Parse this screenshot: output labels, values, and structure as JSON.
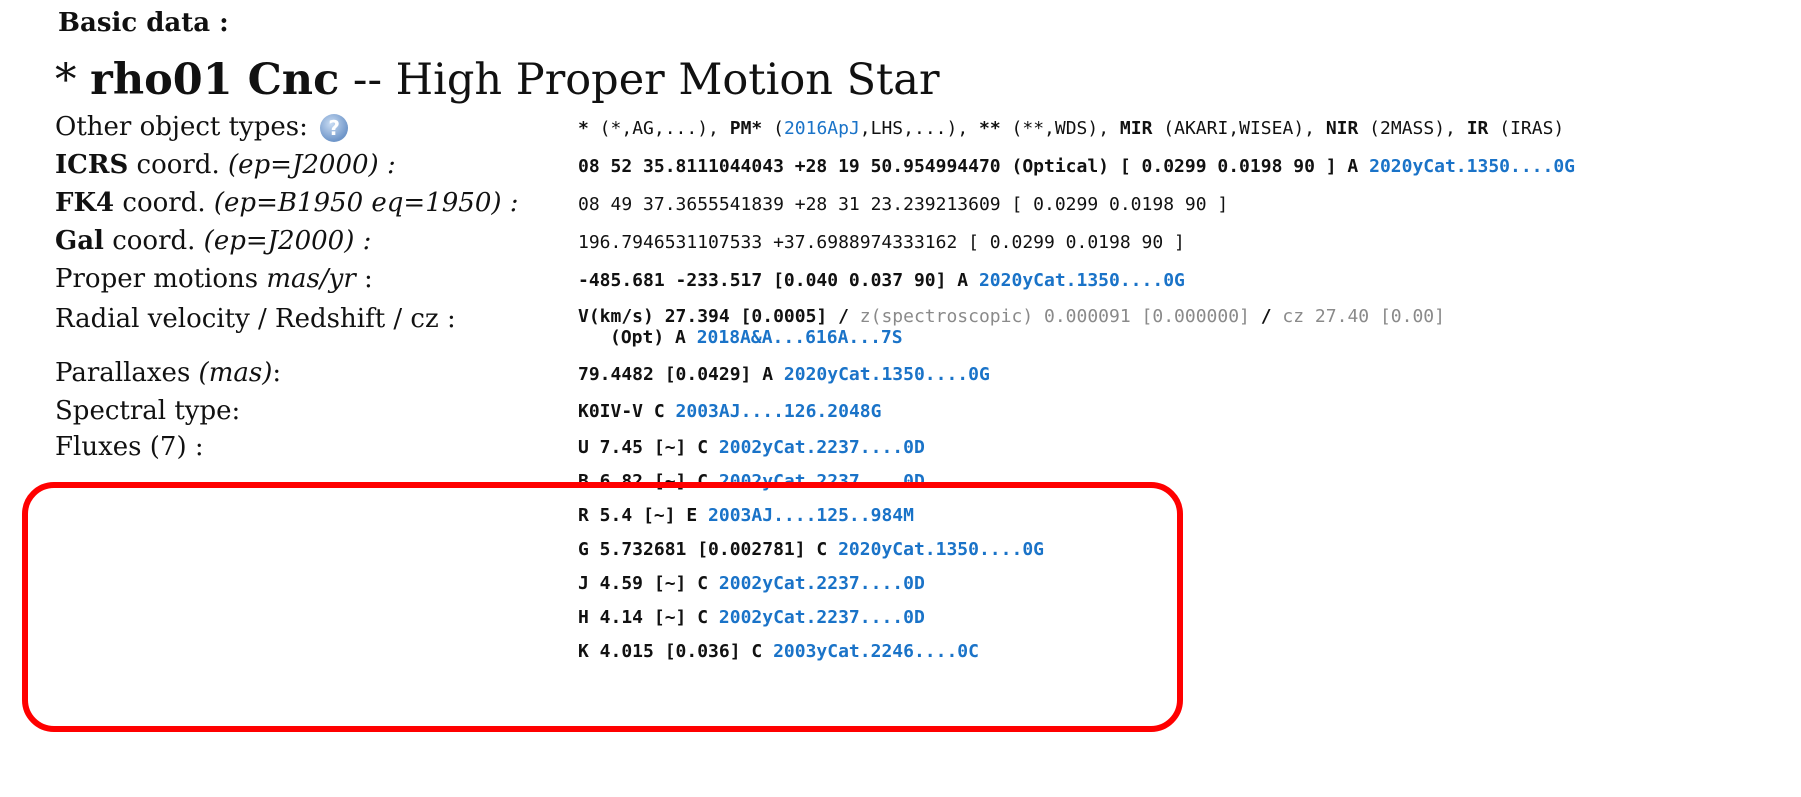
{
  "section_title": "Basic data :",
  "object": {
    "prefix": "* ",
    "name": "rho01 Cnc",
    "separator": " -- ",
    "type": "High Proper Motion Star"
  },
  "labels": {
    "other_types": "Other object types:",
    "icrs_bold": "ICRS",
    "icrs_rest": " coord. ",
    "icrs_italic": "(ep=J2000) :",
    "fk4_bold": "FK4",
    "fk4_rest": " coord. ",
    "fk4_italic": "(ep=B1950 eq=1950) :",
    "gal_bold": "Gal",
    "gal_rest": " coord. ",
    "gal_italic": "(ep=J2000) :",
    "pm_text": "Proper motions ",
    "pm_italic": "mas/yr",
    "pm_tail": " :",
    "rv": "Radial velocity / Redshift / cz :",
    "plx_text": "Parallaxes ",
    "plx_italic": "(mas)",
    "plx_tail": ":",
    "sptype": "Spectral type:",
    "fluxes": "Fluxes (7) :"
  },
  "help_icon_glyph": "?",
  "other_types": {
    "t1": "*",
    "t1_sub": " (*,AG,...), ",
    "t2": "PM*",
    "t2_pre": " (",
    "t2_link": "2016ApJ",
    "t2_post": ",LHS,...), ",
    "t3": "**",
    "t3_sub": " (**,WDS), ",
    "t4": "MIR",
    "t4_sub": " (AKARI,WISEA), ",
    "t5": "NIR",
    "t5_sub": " (2MASS), ",
    "t6": "IR",
    "t6_sub": " (IRAS)"
  },
  "icrs": {
    "value": "08 52 35.8111044043 +28 19 50.954994470 (Optical) [ 0.0299 0.0198 90 ] A ",
    "ref": "2020yCat.1350....0G"
  },
  "fk4": {
    "value": "08 49 37.3655541839 +28 31 23.239213609 [ 0.0299 0.0198 90 ]"
  },
  "gal": {
    "value": "196.7946531107533 +37.6988974333162 [ 0.0299 0.0198 90 ]"
  },
  "pm": {
    "value": "-485.681 -233.517 [0.040 0.037 90] A ",
    "ref": "2020yCat.1350....0G"
  },
  "rv": {
    "v": "V(km/s) 27.394 [0.0005]",
    "sep1": " / ",
    "z": "z(spectroscopic) 0.000091 [0.000000]",
    "sep2": " / ",
    "cz": "cz 27.40 [0.00]",
    "line2": "(Opt) A ",
    "ref": "2018A&A...616A...7S"
  },
  "plx": {
    "value": "79.4482 [0.0429] A ",
    "ref": "2020yCat.1350....0G"
  },
  "sptype": {
    "value": "K0IV-V C ",
    "ref": "2003AJ....126.2048G"
  },
  "fluxes": [
    {
      "text": "U 7.45 [~] C ",
      "ref": "2002yCat.2237....0D"
    },
    {
      "text": "B 6.82 [~] C ",
      "ref": "2002yCat.2237....0D"
    },
    {
      "text": "R 5.4 [~] E ",
      "ref": "2003AJ....125..984M"
    },
    {
      "text": "G 5.732681 [0.002781] C ",
      "ref": "2020yCat.1350....0G"
    },
    {
      "text": "J 4.59 [~] C ",
      "ref": "2002yCat.2237....0D"
    },
    {
      "text": "H 4.14 [~] C ",
      "ref": "2002yCat.2237....0D"
    },
    {
      "text": "K 4.015 [0.036] C ",
      "ref": "2003yCat.2246....0C"
    }
  ],
  "colors": {
    "link": "#1a73c8",
    "highlight": "#ff0000",
    "muted": "#8a8a8a"
  }
}
